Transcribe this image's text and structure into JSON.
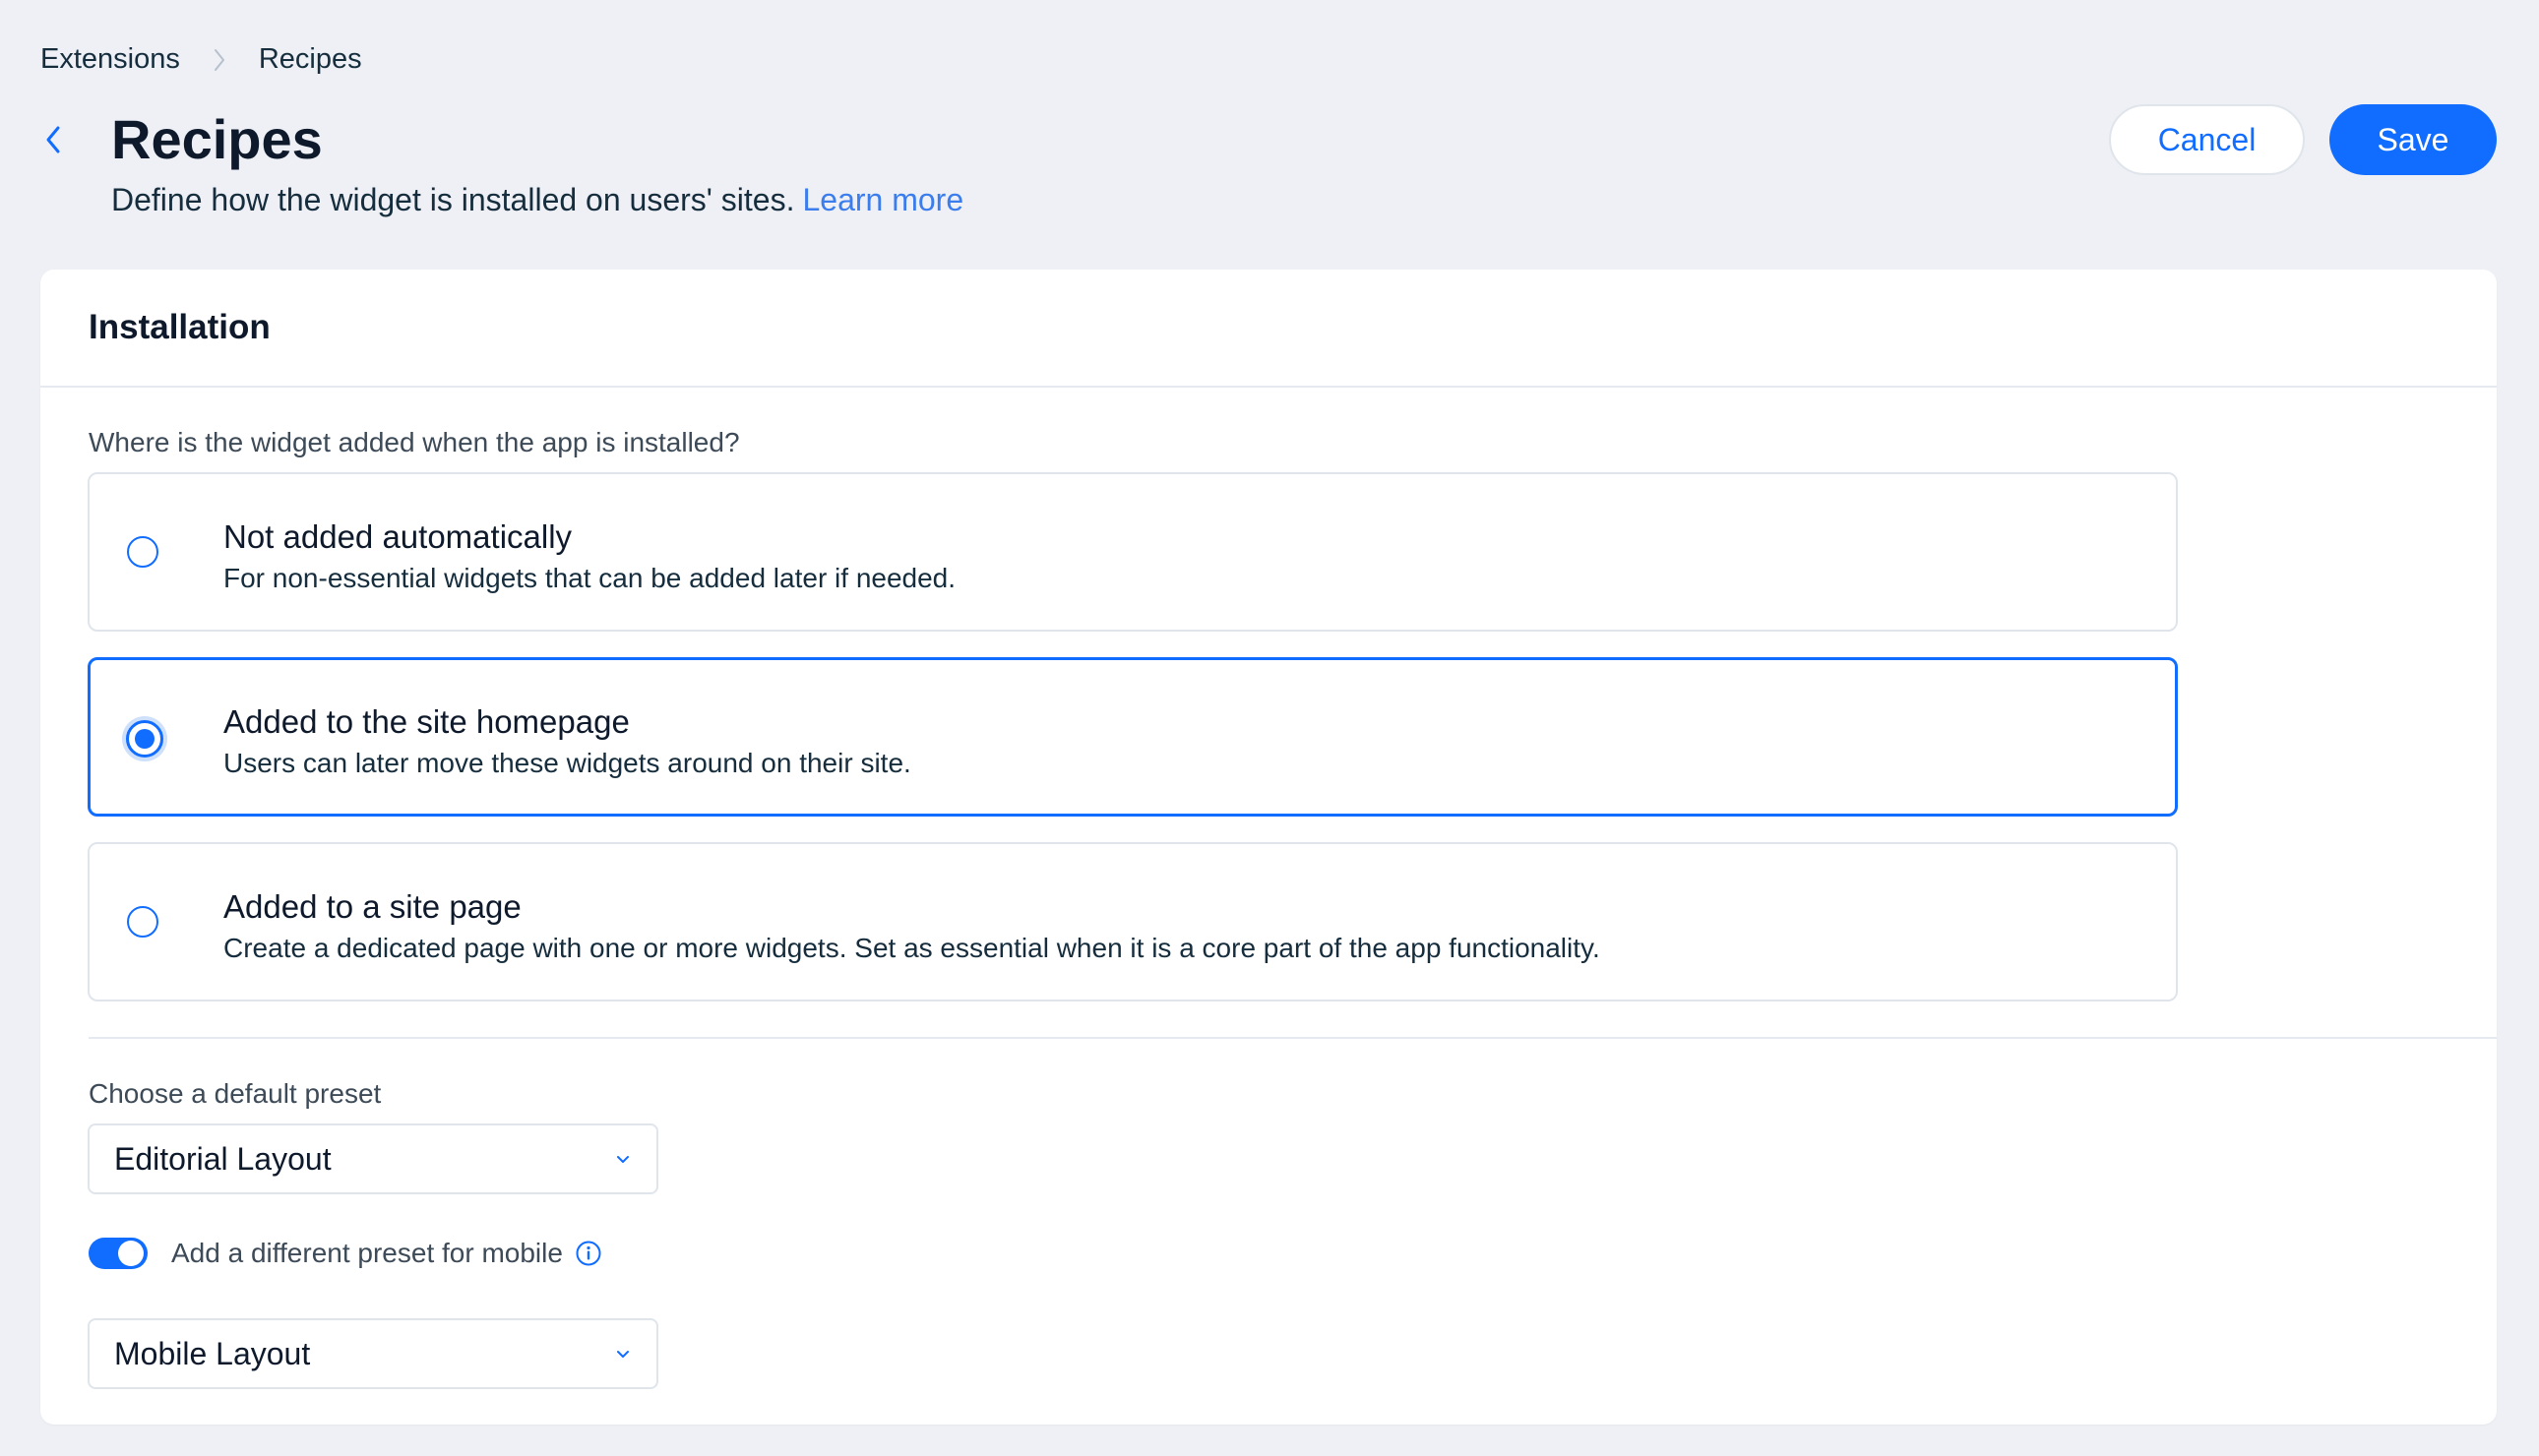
{
  "breadcrumb": {
    "parent": "Extensions",
    "current": "Recipes"
  },
  "header": {
    "title": "Recipes",
    "subtitle": "Define how the widget is installed on users' sites.",
    "learn_more": "Learn more",
    "cancel_label": "Cancel",
    "save_label": "Save"
  },
  "installation": {
    "title": "Installation",
    "question": "Where is the widget added when the app is installed?",
    "options": [
      {
        "title": "Not added automatically",
        "description": "For non-essential widgets that can be added later if needed.",
        "selected": false
      },
      {
        "title": "Added to the site homepage",
        "description": "Users can later move these widgets around on their site.",
        "selected": true
      },
      {
        "title": "Added to a site page",
        "description": "Create a dedicated page with one or more widgets. Set as essential when it is a core part of the app functionality.",
        "selected": false
      }
    ],
    "preset_label": "Choose a default preset",
    "preset_value": "Editorial Layout",
    "mobile_toggle_label": "Add a different preset for mobile",
    "mobile_toggle_on": true,
    "mobile_preset_value": "Mobile Layout"
  },
  "colors": {
    "accent": "#116dff",
    "background": "#eef0f5",
    "card": "#ffffff",
    "border": "#dfe5eb",
    "text": "#162d3d"
  },
  "icons": {
    "breadcrumb_separator": "chevron-right-icon",
    "back": "chevron-left-icon",
    "dropdown": "chevron-down-icon",
    "info": "info-icon"
  }
}
